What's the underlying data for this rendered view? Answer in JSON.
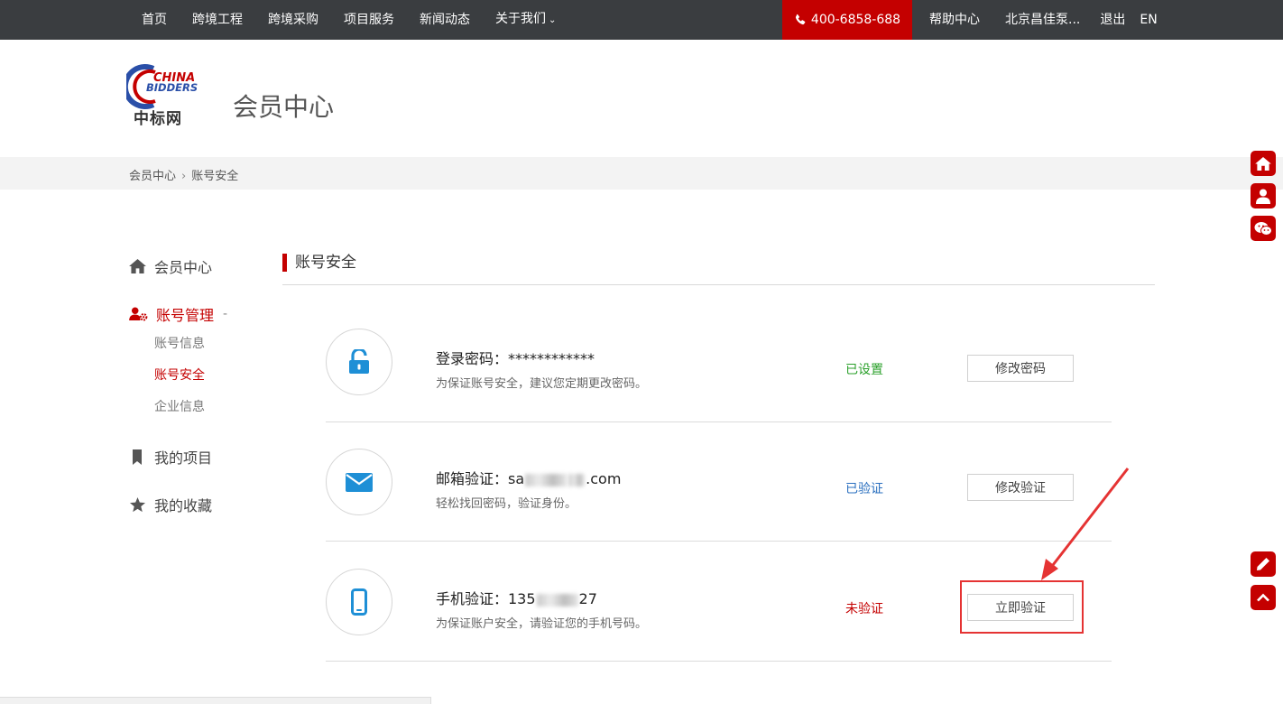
{
  "topnav": {
    "items": [
      "首页",
      "跨境工程",
      "跨境采购",
      "项目服务",
      "新闻动态",
      "关于我们"
    ],
    "about_caret": "ˇ",
    "phone": "400-6858-688",
    "right_items": [
      "帮助中心",
      "北京昌佳泵...",
      "退出",
      "EN"
    ]
  },
  "header": {
    "logo_text_en_1": "CHINA",
    "logo_text_en_2": "BIDDERS",
    "logo_text_cn": "中标网",
    "title": "会员中心"
  },
  "breadcrumb": {
    "home": "会员中心",
    "sep": "›",
    "current": "账号安全"
  },
  "sidebar": {
    "member_center": "会员中心",
    "account_manage": "账号管理",
    "account_manage_toggle": "-",
    "sub_items": [
      "账号信息",
      "账号安全",
      "企业信息"
    ],
    "my_projects": "我的项目",
    "my_favorites": "我的收藏"
  },
  "section": {
    "title": "账号安全"
  },
  "rows": [
    {
      "label": "登录密码：************",
      "desc": "为保证账号安全，建议您定期更改密码。",
      "status": "已设置",
      "status_color": "#2aa02a",
      "button": "修改密码",
      "icon": "unlock-icon"
    },
    {
      "label_prefix": "邮箱验证：sa",
      "label_suffix": ".com",
      "desc": "轻松找回密码，验证身份。",
      "status": "已验证",
      "status_color": "#2a6fbf",
      "button": "修改验证",
      "icon": "envelope-icon"
    },
    {
      "label_prefix": "手机验证：135",
      "label_suffix": "27",
      "desc": "为保证账户安全，请验证您的手机号码。",
      "status": "未验证",
      "status_color": "#c40000",
      "button": "立即验证",
      "icon": "mobile-icon"
    }
  ],
  "colors": {
    "brand_red": "#c40000",
    "topbar_bg": "#3a3d40",
    "icon_blue": "#1e8fd6",
    "annotation_red": "#e53333"
  }
}
